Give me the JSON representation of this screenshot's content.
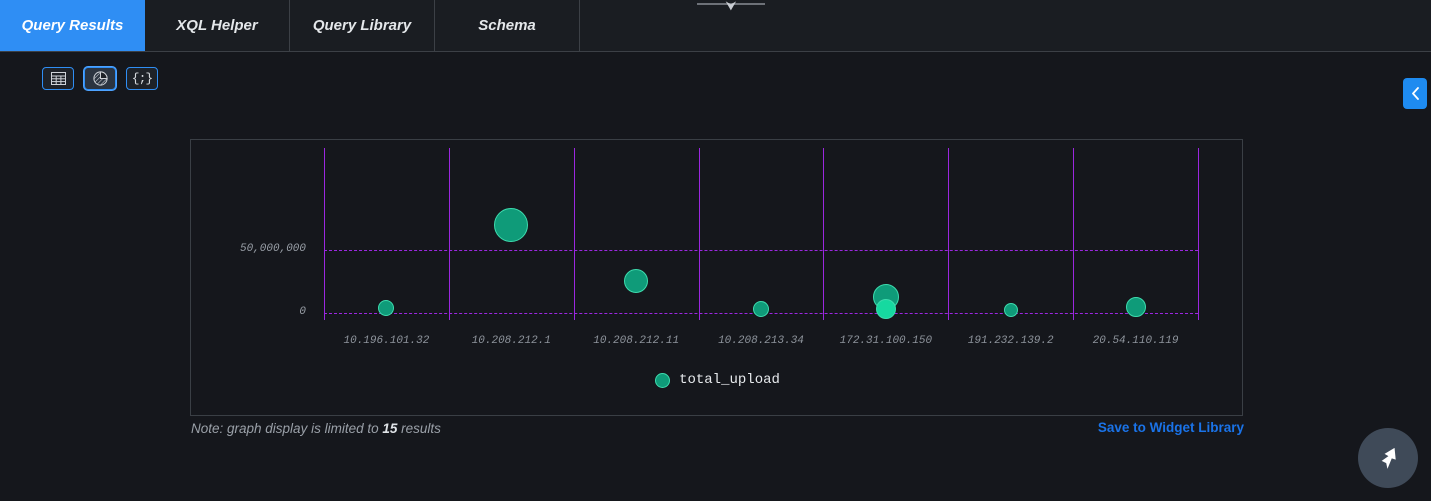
{
  "window": {
    "drag_handle_icon": "drag-down-arrow-icon",
    "background_color": "#15171c"
  },
  "tabs": {
    "items": [
      {
        "label": "Query Results",
        "active": true
      },
      {
        "label": "XQL Helper",
        "active": false
      },
      {
        "label": "Query Library",
        "active": false
      },
      {
        "label": "Schema",
        "active": false
      }
    ],
    "active_color": "#2f8ef4"
  },
  "toolbar": {
    "buttons": [
      {
        "name": "table-view-button",
        "icon": "table-icon",
        "active": false
      },
      {
        "name": "chart-view-button",
        "icon": "pie-chart-icon",
        "active": true
      },
      {
        "name": "json-view-button",
        "icon": "json-braces-icon",
        "label": "{;}",
        "active": false
      }
    ]
  },
  "side_panel": {
    "collapse_icon": "chevron-left-icon",
    "color": "#1e8bf0"
  },
  "chart_data": {
    "type": "scatter",
    "title": "",
    "xlabel": "",
    "ylabel": "",
    "categories": [
      "10.196.101.32",
      "10.208.212.1",
      "10.208.212.11",
      "10.208.213.34",
      "172.31.100.150",
      "191.232.139.2",
      "20.54.110.119"
    ],
    "ytick_labels": [
      "50,000,000",
      "0"
    ],
    "ytick_values": [
      50000000,
      0
    ],
    "ylim": [
      0,
      70000000
    ],
    "grid": true,
    "grid_color": "#9b27e0",
    "legend": [
      {
        "name": "total_upload",
        "color": "#0f9b79"
      }
    ],
    "legend_position": "bottom-center",
    "series": [
      {
        "name": "total_upload",
        "points": [
          {
            "x": "10.196.101.32",
            "y": 4000000,
            "size": 8,
            "color": "#0f9b79"
          },
          {
            "x": "10.208.212.1",
            "y": 70000000,
            "size": 17,
            "color": "#0f9b79"
          },
          {
            "x": "10.208.212.11",
            "y": 25500000,
            "size": 12,
            "color": "#0f9b79"
          },
          {
            "x": "10.208.213.34",
            "y": 2800000,
            "size": 8,
            "color": "#0f9b79"
          },
          {
            "x": "172.31.100.150",
            "y": 13000000,
            "size": 13,
            "color": "#0f9b79"
          },
          {
            "x": "172.31.100.150",
            "y": 3000000,
            "size": 10,
            "color": "#16d9a0"
          },
          {
            "x": "191.232.139.2",
            "y": 2200000,
            "size": 7,
            "color": "#0f9b79"
          },
          {
            "x": "20.54.110.119",
            "y": 4600000,
            "size": 10,
            "color": "#0f9b79"
          }
        ]
      }
    ]
  },
  "footer": {
    "note_prefix": "Note: graph display is limited to ",
    "note_count": "15",
    "note_suffix": " results",
    "save_link": "Save to Widget Library"
  },
  "fab": {
    "icon": "cursor-arrow-icon"
  }
}
